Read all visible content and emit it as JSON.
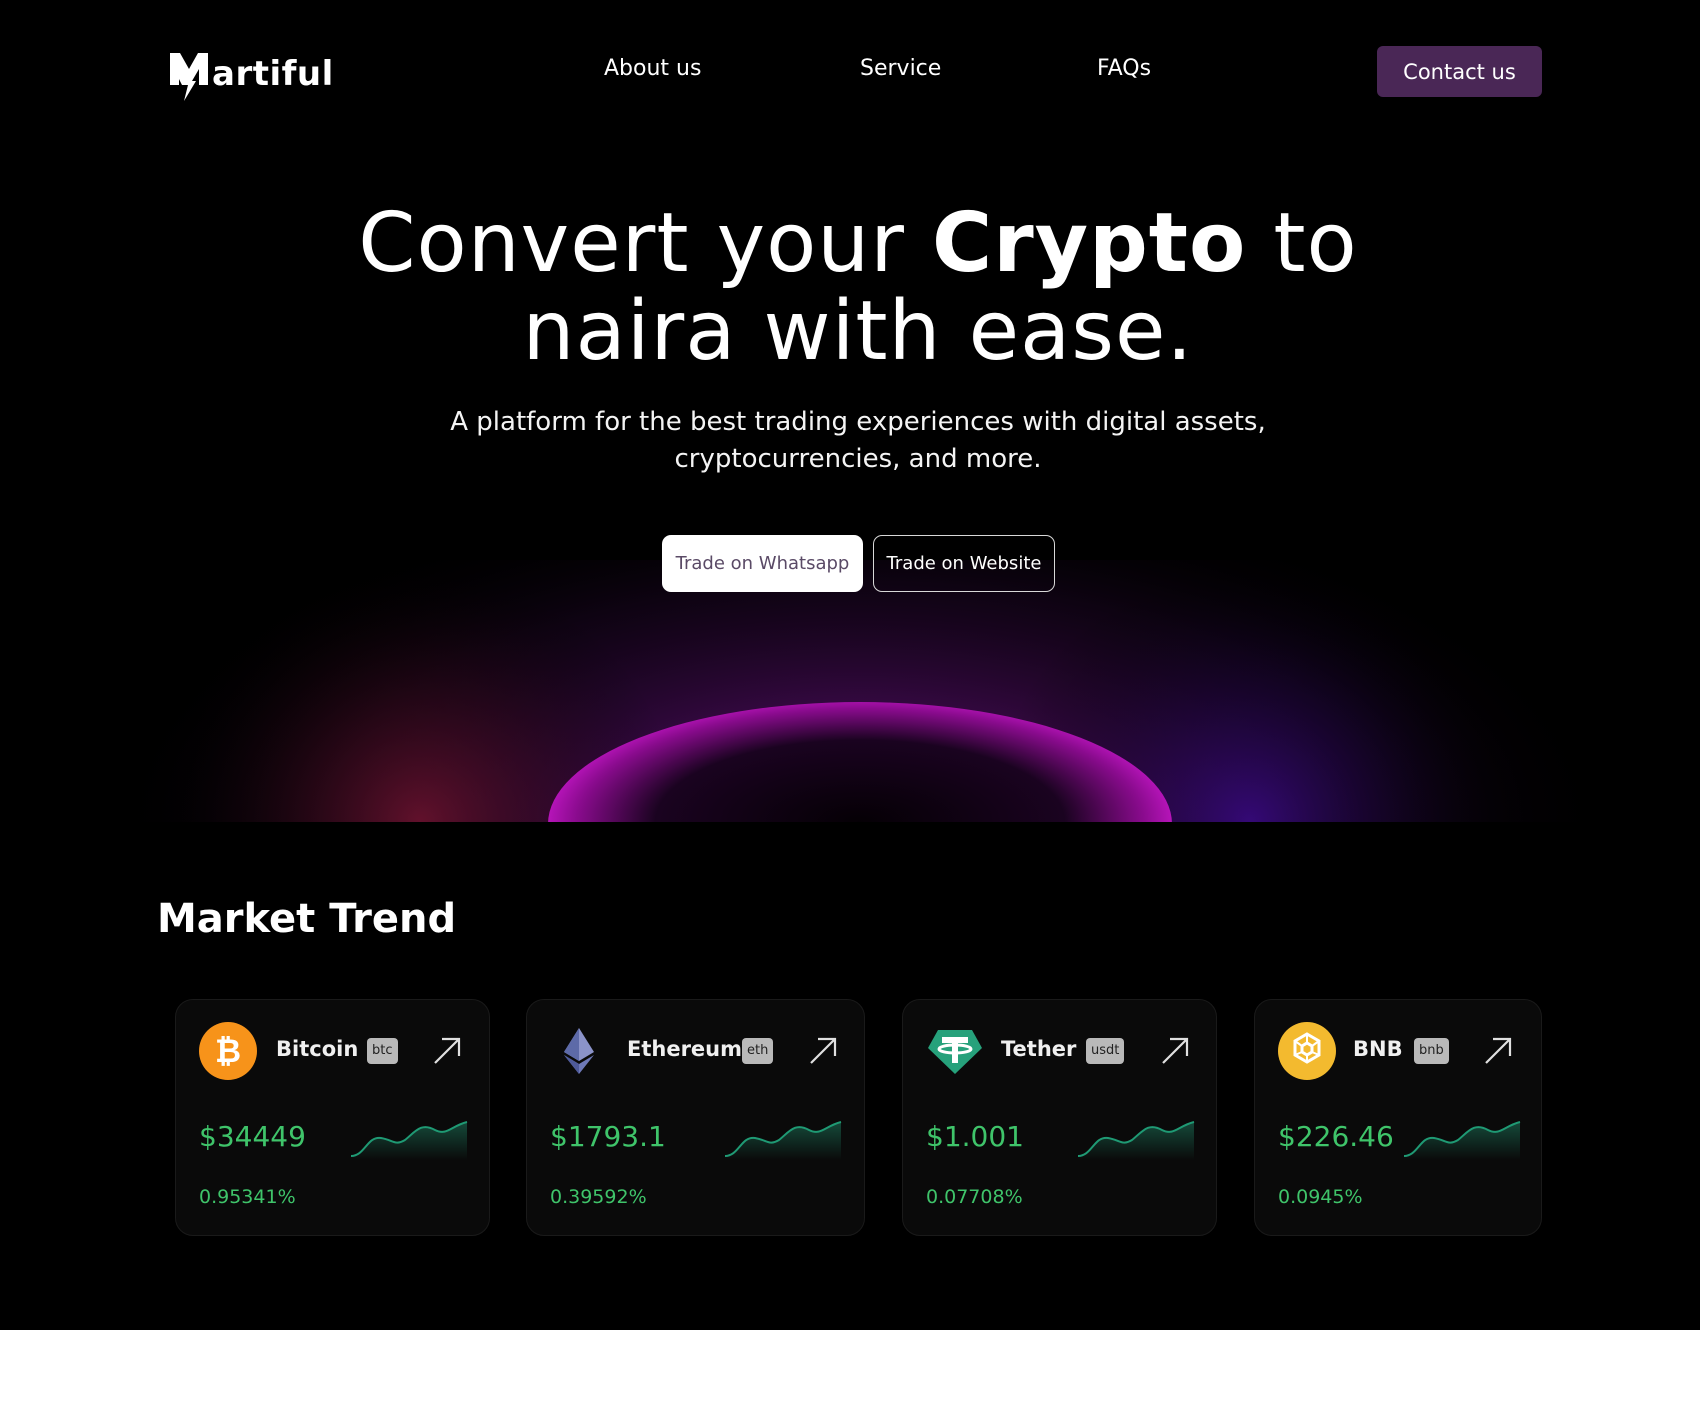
{
  "nav": {
    "logo_text": "artiful",
    "links": [
      "About us",
      "Service",
      "FAQs"
    ],
    "contact_label": "Contact us"
  },
  "hero": {
    "title_part1": "Convert your ",
    "title_bold": "Crypto",
    "title_part2": " to",
    "title_line2": "naira with ease.",
    "subtitle_line1": "A platform for the best trading experiences with digital assets,",
    "subtitle_line2": "cryptocurrencies, and more.",
    "whatsapp_label": "Trade on Whatsapp",
    "website_label": "Trade on Website"
  },
  "market": {
    "title": "Market Trend",
    "coins": [
      {
        "name": "Bitcoin",
        "ticker": "btc",
        "price": "$34449",
        "change": "0.95341%",
        "icon": "bitcoin-icon",
        "color": "#f7931a"
      },
      {
        "name": "Ethereum",
        "ticker": "eth",
        "price": "$1793.1",
        "change": "0.39592%",
        "icon": "ethereum-icon",
        "color": "#627eea"
      },
      {
        "name": "Tether",
        "ticker": "usdt",
        "price": "$1.001",
        "change": "0.07708%",
        "icon": "tether-icon",
        "color": "#26a17b"
      },
      {
        "name": "BNB",
        "ticker": "bnb",
        "price": "$226.46",
        "change": "0.0945%",
        "icon": "bnb-icon",
        "color": "#f3ba2f"
      }
    ]
  },
  "colors": {
    "background": "#000000",
    "accent": "#4a2756",
    "positive": "#3fc46a",
    "glow": "#c816c8"
  }
}
